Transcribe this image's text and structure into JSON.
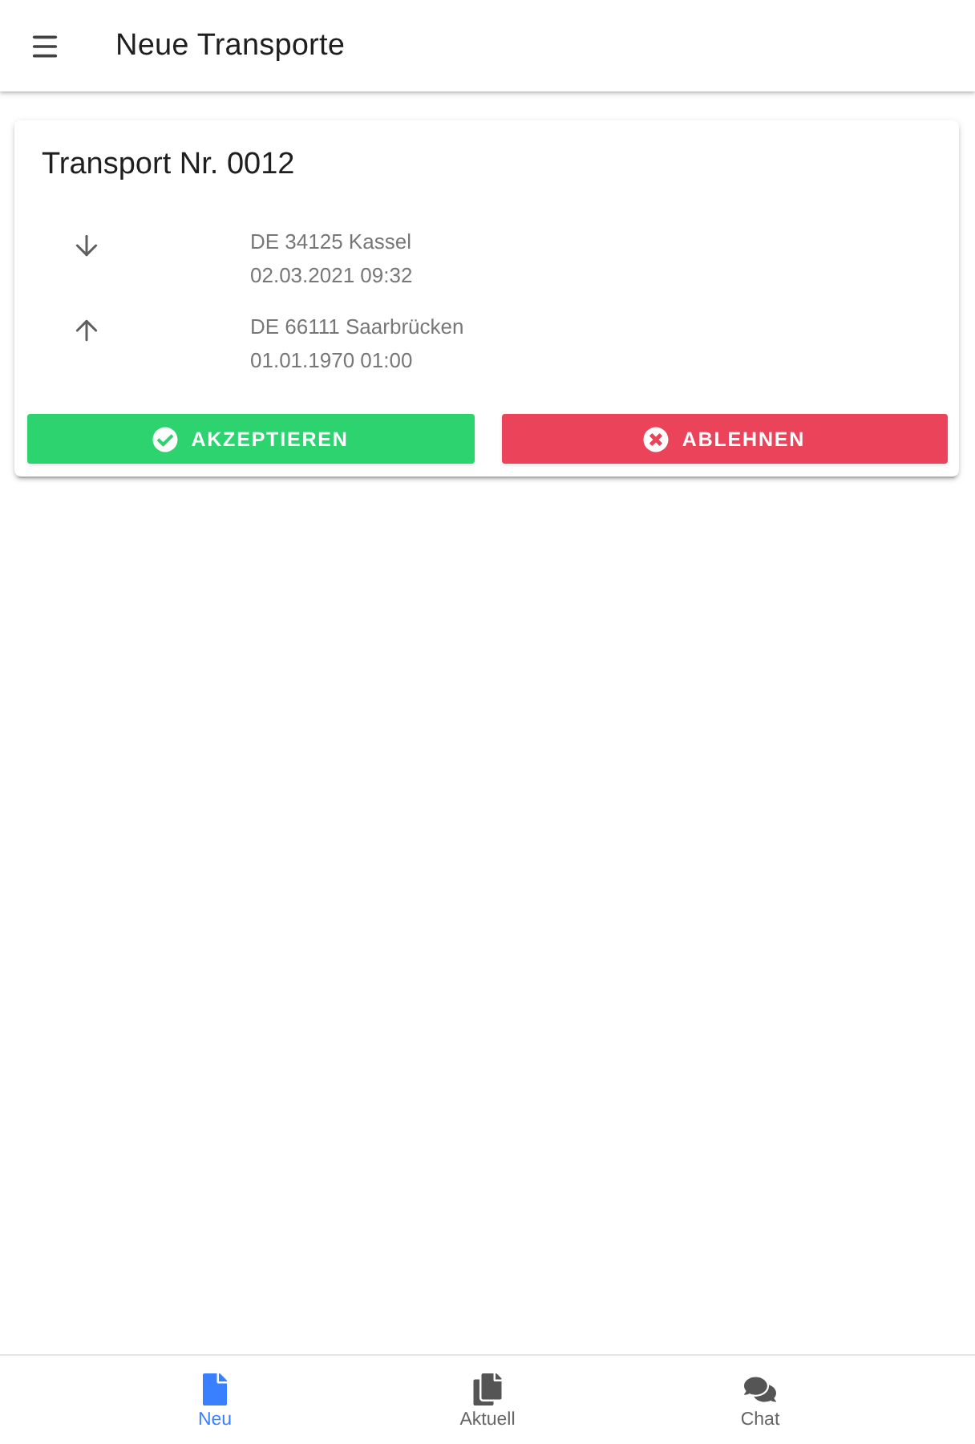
{
  "app_bar": {
    "title": "Neue Transporte"
  },
  "transports": [
    {
      "title": "Transport Nr. 0012",
      "stops": [
        {
          "kind": "down",
          "place": "DE 34125 Kassel",
          "time": "02.03.2021 09:32"
        },
        {
          "kind": "up",
          "place": "DE 66111 Saarbrücken",
          "time": "01.01.1970 01:00"
        }
      ],
      "actions": [
        {
          "kind": "accept",
          "label": "AKZEPTIEREN"
        },
        {
          "kind": "reject",
          "label": "ABLEHNEN"
        }
      ]
    }
  ],
  "bottom_nav": [
    {
      "kind": "new",
      "label": "Neu",
      "selected": true
    },
    {
      "kind": "current",
      "label": "Aktuell",
      "selected": false
    },
    {
      "kind": "chat",
      "label": "Chat",
      "selected": false
    }
  ]
}
